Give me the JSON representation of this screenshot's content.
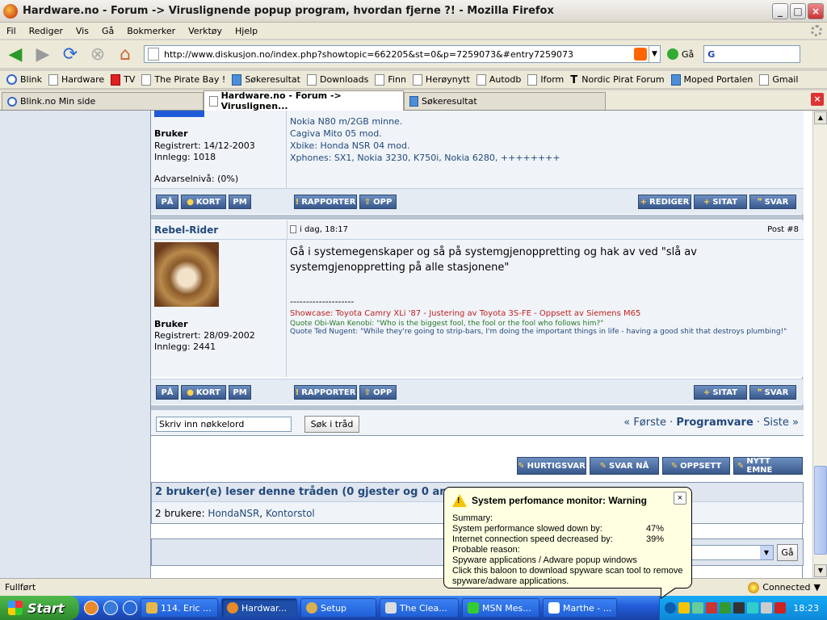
{
  "window": {
    "title": "Hardware.no - Forum -> Viruslignende popup program, hvordan fjerne ?! - Mozilla Firefox"
  },
  "menu": [
    "Fil",
    "Rediger",
    "Vis",
    "Gå",
    "Bokmerker",
    "Verktøy",
    "Hjelp"
  ],
  "nav": {
    "url": "http://www.diskusjon.no/index.php?showtopic=662205&st=0&p=7259073&#entry7259073",
    "go_label": "Gå",
    "search_value": ""
  },
  "bookmarks": [
    "Blink",
    "Hardware",
    "TV",
    "The Pirate Bay !",
    "Søkeresultat",
    "Downloads",
    "Finn",
    "Herøynytt",
    "Autodb",
    "Iform",
    "Nordic Pirat Forum",
    "Moped Portalen",
    "Gmail"
  ],
  "tabs": [
    "Blink.no Min side",
    "Hardware.no - Forum -> Viruslignen...",
    "Søkeresultat"
  ],
  "post1": {
    "sig_lines": [
      "Nokia N80 m/2GB minne.",
      "Cagiva Mito 05 mod.",
      "Xbike: Honda NSR 04 mod.",
      "Xphones: SX1, Nokia 3230, K750i, Nokia 6280, ++++++++"
    ],
    "rank": "Bruker",
    "registered": "Registrert: 14/12-2003",
    "posts": "Innlegg: 1018",
    "warn": "Advarselnivå: (0%)"
  },
  "post2": {
    "author": "Rebel-Rider",
    "time": "i dag, 18:17",
    "post_no": "Post #8",
    "text": "Gå i systemegenskaper og så på systemgjenoppretting og hak av ved \"slå av systemgjenoppretting på alle stasjonene\"",
    "divider": "--------------------",
    "sig1a": "Showcase: Toyota Camry XLi '87",
    "sig1b": " - Justering av Toyota 3S-FE - ",
    "sig1c": "Oppsett av Siemens M65",
    "sig2": "Quote Obi-Wan Kenobi: \"Who is the biggest fool, the fool or the fool who follows him?\"",
    "sig3": "Quote Ted Nugent: \"While they're going to strip-bars, I'm doing the important things in life - having a good shit that destroys plumbing!\"",
    "rank": "Bruker",
    "registered": "Registrert: 28/09-2002",
    "posts": "Innlegg: 2441"
  },
  "buttons": {
    "pa": "PÅ",
    "kort": "KORT",
    "pm": "PM",
    "rapporter": "RAPPORTER",
    "opp": "OPP",
    "rediger": "REDIGER",
    "sitat": "SITAT",
    "svar": "SVAR"
  },
  "topic_search": {
    "placeholder": "Skriv inn nøkkelord",
    "button": "Søk i tråd"
  },
  "pager": {
    "first": "« Første",
    "sep1": " · ",
    "current": "Programvare",
    "sep2": " · ",
    "last": "Siste »"
  },
  "actions": [
    "HURTIGSVAR",
    "SVAR NÅ",
    "OPPSETT",
    "NYTT EMNE"
  ],
  "readers": {
    "heading": "2 bruker(e) leser denne tråden (0 gjester og 0 an",
    "label": "2 brukere: ",
    "users": [
      "HondaNSR",
      "Kontorstol"
    ]
  },
  "jump_go": "Gå",
  "status": {
    "text": "Fullført",
    "conn": "Connected"
  },
  "taskbar": {
    "start": "Start",
    "items": [
      "114. Eric ...",
      "Hardwar...",
      "Setup",
      "The Clea...",
      "MSN Mes...",
      "Marthe - ..."
    ],
    "clock": "18:23"
  },
  "balloon": {
    "title": "System perfomance monitor: Warning",
    "summary": "Summary:",
    "rows": [
      {
        "k": "System performance slowed down by:",
        "v": "47%"
      },
      {
        "k": "Internet connection speed decreased by:",
        "v": "39%"
      }
    ],
    "reason_label": "Probable reason:",
    "reason": "Spyware applications / Adware popup windows",
    "cta": "Click this baloon to download spyware scan tool to remove spyware/adware applications."
  },
  "colors": {
    "forum_blue": "#23497b",
    "button_blue": "#39588c",
    "sig_red": "#c02020",
    "sig_green": "#2a7a2a"
  }
}
